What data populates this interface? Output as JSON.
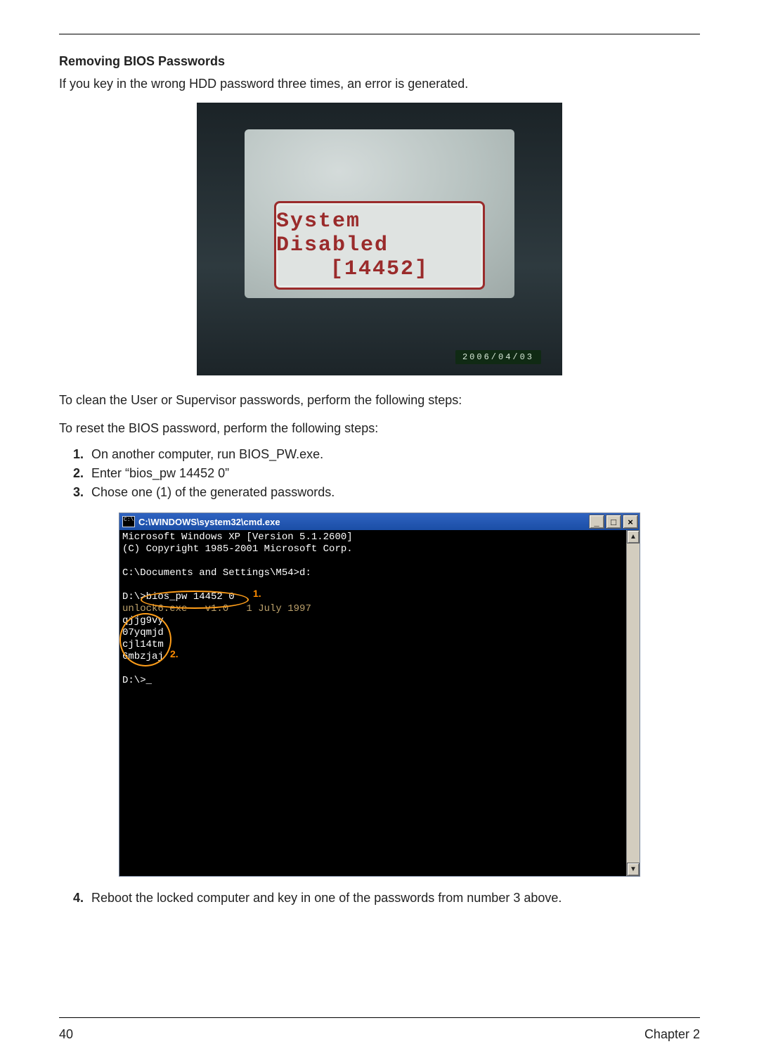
{
  "heading": "Removing BIOS Passwords",
  "intro": "If you key in the wrong HDD password three times, an error is generated.",
  "fig1": {
    "line1": "System Disabled",
    "line2": "[14452]",
    "stamp": "2006/04/03"
  },
  "para2": "To clean the User or Supervisor passwords, perform the following steps:",
  "para3": "To reset the BIOS password, perform the following steps:",
  "steps_a": [
    "On another computer, run BIOS_PW.exe.",
    "Enter “bios_pw 14452 0”",
    "Chose one (1) of the generated passwords."
  ],
  "cmd": {
    "title": "C:\\WINDOWS\\system32\\cmd.exe",
    "lines": {
      "l1": "Microsoft Windows XP [Version 5.1.2600]",
      "l2": "(C) Copyright 1985-2001 Microsoft Corp.",
      "l3": "C:\\Documents and Settings\\M54>d:",
      "l4": "D:\\>bios_pw 14452 0",
      "l5": "unlock6.exe   v1.0   1 July 1997",
      "l6": "qjjg9vy",
      "l7": "07yqmjd",
      "l8": "cjl14tm",
      "l9": "6mbzjaj",
      "l10": "D:\\>_"
    },
    "callout1": "1.",
    "callout2": "2."
  },
  "step4": "Reboot the locked computer and key in one of the passwords from number 3 above.",
  "footer": {
    "page": "40",
    "chapter": "Chapter 2"
  }
}
